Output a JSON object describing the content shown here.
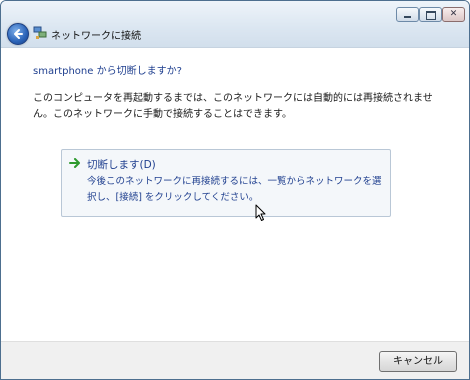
{
  "window": {
    "title": "ネットワークに接続",
    "controls": {
      "minimize": "minimize",
      "maximize": "maximize",
      "close": "close"
    }
  },
  "content": {
    "heading": "smartphone から切断しますか?",
    "description": "このコンピュータを再起動するまでは、このネットワークには自動的には再接続されません。このネットワークに手動で接続することはできます。",
    "option": {
      "title": "切断します(D)",
      "description": "今後このネットワークに再接続するには、一覧からネットワークを選択し、[接続] をクリックしてください。"
    }
  },
  "footer": {
    "cancel_label": "キャンセル"
  },
  "colors": {
    "link_blue": "#1f3f8f",
    "arrow_green": "#2e9a2e",
    "title_gradient_top": "#eef4fa"
  },
  "icons": [
    "back-arrow-icon",
    "network-icon",
    "minimize-icon",
    "maximize-icon",
    "close-icon",
    "green-arrow-icon",
    "mouse-cursor-icon"
  ]
}
